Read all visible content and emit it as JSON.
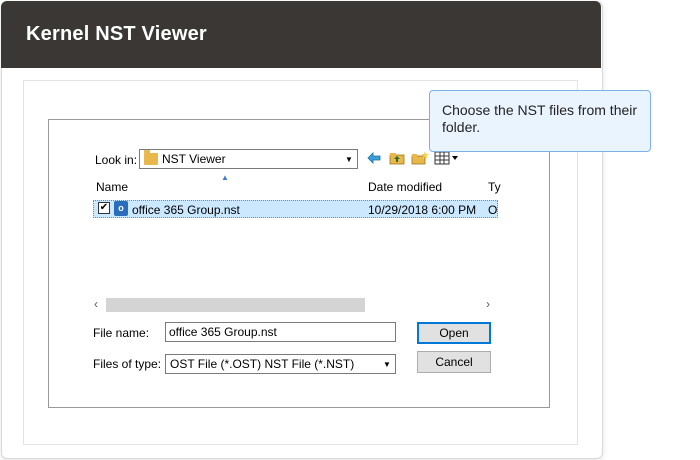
{
  "header": {
    "title": "Kernel NST Viewer"
  },
  "callout": {
    "text": "Choose the NST files from their folder."
  },
  "dialog": {
    "look_in_label": "Look in:",
    "look_in_value": "NST Viewer",
    "toolbar_icons": [
      "back-arrow-icon",
      "up-folder-icon",
      "new-folder-icon",
      "view-menu-icon"
    ],
    "columns": {
      "name": "Name",
      "date_modified": "Date modified",
      "type": "Ty"
    },
    "files": [
      {
        "checked": true,
        "name": "office 365 Group.nst",
        "date_modified": "10/29/2018 6:00 PM",
        "type": "O"
      }
    ],
    "scroll_left": "‹",
    "scroll_right": "›",
    "file_name_label": "File name:",
    "file_name_value": "office 365 Group.nst",
    "files_of_type_label": "Files of type:",
    "files_of_type_value": "OST File (*.OST) NST File (*.NST)",
    "open_label": "Open",
    "cancel_label": "Cancel"
  },
  "colors": {
    "header_bg": "#3b3735",
    "selection": "#cce8ff",
    "callout_bg": "#eaf4ff"
  }
}
